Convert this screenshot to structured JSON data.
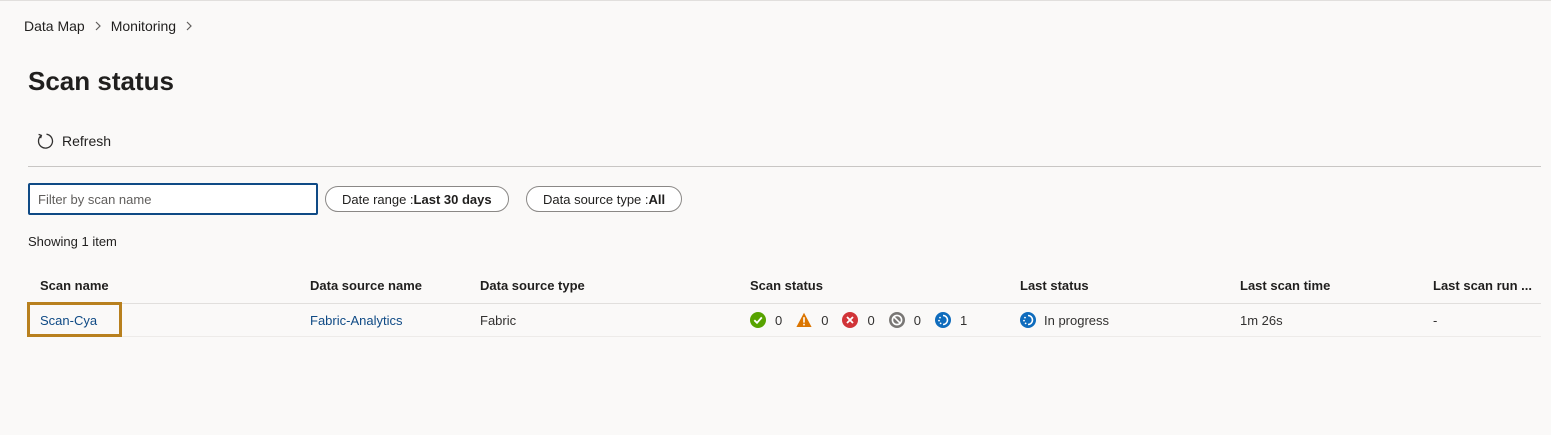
{
  "breadcrumb": {
    "items": [
      "Data Map",
      "Monitoring"
    ]
  },
  "page": {
    "title": "Scan status"
  },
  "toolbar": {
    "refresh_label": "Refresh"
  },
  "filters": {
    "search_placeholder": "Filter by scan name",
    "search_value": "",
    "date_range_label": "Date range : ",
    "date_range_value": "Last 30 days",
    "source_type_label": "Data source type : ",
    "source_type_value": "All"
  },
  "summary": {
    "showing": "Showing 1 item"
  },
  "table": {
    "columns": [
      "Scan name",
      "Data source name",
      "Data source type",
      "Scan status",
      "Last status",
      "Last scan time",
      "Last scan run ..."
    ],
    "rows": [
      {
        "scan_name": "Scan-Cya",
        "data_source_name": "Fabric-Analytics",
        "data_source_type": "Fabric",
        "status_counts": {
          "succeeded": "0",
          "warning": "0",
          "failed": "0",
          "canceled": "0",
          "in_progress": "1"
        },
        "last_status": "In progress",
        "last_scan_time": "1m 26s",
        "last_scan_run": "-"
      }
    ]
  },
  "colors": {
    "accent": "#0f4a85",
    "success": "#57a300",
    "warning": "#db7500",
    "error": "#d13438",
    "canceled": "#797775",
    "progress": "#0f6cbd",
    "highlight": "#b8801e"
  },
  "icons": [
    "chevron-right-icon",
    "refresh-icon",
    "success-icon",
    "warning-icon",
    "error-icon",
    "canceled-icon",
    "in-progress-icon"
  ]
}
